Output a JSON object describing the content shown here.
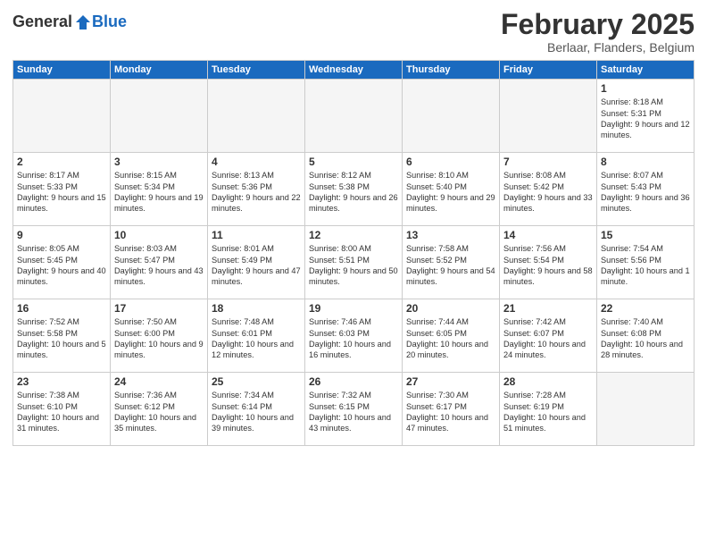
{
  "logo": {
    "general": "General",
    "blue": "Blue"
  },
  "header": {
    "month": "February 2025",
    "location": "Berlaar, Flanders, Belgium"
  },
  "weekdays": [
    "Sunday",
    "Monday",
    "Tuesday",
    "Wednesday",
    "Thursday",
    "Friday",
    "Saturday"
  ],
  "weeks": [
    [
      {
        "day": "",
        "info": ""
      },
      {
        "day": "",
        "info": ""
      },
      {
        "day": "",
        "info": ""
      },
      {
        "day": "",
        "info": ""
      },
      {
        "day": "",
        "info": ""
      },
      {
        "day": "",
        "info": ""
      },
      {
        "day": "1",
        "info": "Sunrise: 8:18 AM\nSunset: 5:31 PM\nDaylight: 9 hours and 12 minutes."
      }
    ],
    [
      {
        "day": "2",
        "info": "Sunrise: 8:17 AM\nSunset: 5:33 PM\nDaylight: 9 hours and 15 minutes."
      },
      {
        "day": "3",
        "info": "Sunrise: 8:15 AM\nSunset: 5:34 PM\nDaylight: 9 hours and 19 minutes."
      },
      {
        "day": "4",
        "info": "Sunrise: 8:13 AM\nSunset: 5:36 PM\nDaylight: 9 hours and 22 minutes."
      },
      {
        "day": "5",
        "info": "Sunrise: 8:12 AM\nSunset: 5:38 PM\nDaylight: 9 hours and 26 minutes."
      },
      {
        "day": "6",
        "info": "Sunrise: 8:10 AM\nSunset: 5:40 PM\nDaylight: 9 hours and 29 minutes."
      },
      {
        "day": "7",
        "info": "Sunrise: 8:08 AM\nSunset: 5:42 PM\nDaylight: 9 hours and 33 minutes."
      },
      {
        "day": "8",
        "info": "Sunrise: 8:07 AM\nSunset: 5:43 PM\nDaylight: 9 hours and 36 minutes."
      }
    ],
    [
      {
        "day": "9",
        "info": "Sunrise: 8:05 AM\nSunset: 5:45 PM\nDaylight: 9 hours and 40 minutes."
      },
      {
        "day": "10",
        "info": "Sunrise: 8:03 AM\nSunset: 5:47 PM\nDaylight: 9 hours and 43 minutes."
      },
      {
        "day": "11",
        "info": "Sunrise: 8:01 AM\nSunset: 5:49 PM\nDaylight: 9 hours and 47 minutes."
      },
      {
        "day": "12",
        "info": "Sunrise: 8:00 AM\nSunset: 5:51 PM\nDaylight: 9 hours and 50 minutes."
      },
      {
        "day": "13",
        "info": "Sunrise: 7:58 AM\nSunset: 5:52 PM\nDaylight: 9 hours and 54 minutes."
      },
      {
        "day": "14",
        "info": "Sunrise: 7:56 AM\nSunset: 5:54 PM\nDaylight: 9 hours and 58 minutes."
      },
      {
        "day": "15",
        "info": "Sunrise: 7:54 AM\nSunset: 5:56 PM\nDaylight: 10 hours and 1 minute."
      }
    ],
    [
      {
        "day": "16",
        "info": "Sunrise: 7:52 AM\nSunset: 5:58 PM\nDaylight: 10 hours and 5 minutes."
      },
      {
        "day": "17",
        "info": "Sunrise: 7:50 AM\nSunset: 6:00 PM\nDaylight: 10 hours and 9 minutes."
      },
      {
        "day": "18",
        "info": "Sunrise: 7:48 AM\nSunset: 6:01 PM\nDaylight: 10 hours and 12 minutes."
      },
      {
        "day": "19",
        "info": "Sunrise: 7:46 AM\nSunset: 6:03 PM\nDaylight: 10 hours and 16 minutes."
      },
      {
        "day": "20",
        "info": "Sunrise: 7:44 AM\nSunset: 6:05 PM\nDaylight: 10 hours and 20 minutes."
      },
      {
        "day": "21",
        "info": "Sunrise: 7:42 AM\nSunset: 6:07 PM\nDaylight: 10 hours and 24 minutes."
      },
      {
        "day": "22",
        "info": "Sunrise: 7:40 AM\nSunset: 6:08 PM\nDaylight: 10 hours and 28 minutes."
      }
    ],
    [
      {
        "day": "23",
        "info": "Sunrise: 7:38 AM\nSunset: 6:10 PM\nDaylight: 10 hours and 31 minutes."
      },
      {
        "day": "24",
        "info": "Sunrise: 7:36 AM\nSunset: 6:12 PM\nDaylight: 10 hours and 35 minutes."
      },
      {
        "day": "25",
        "info": "Sunrise: 7:34 AM\nSunset: 6:14 PM\nDaylight: 10 hours and 39 minutes."
      },
      {
        "day": "26",
        "info": "Sunrise: 7:32 AM\nSunset: 6:15 PM\nDaylight: 10 hours and 43 minutes."
      },
      {
        "day": "27",
        "info": "Sunrise: 7:30 AM\nSunset: 6:17 PM\nDaylight: 10 hours and 47 minutes."
      },
      {
        "day": "28",
        "info": "Sunrise: 7:28 AM\nSunset: 6:19 PM\nDaylight: 10 hours and 51 minutes."
      },
      {
        "day": "",
        "info": ""
      }
    ]
  ]
}
